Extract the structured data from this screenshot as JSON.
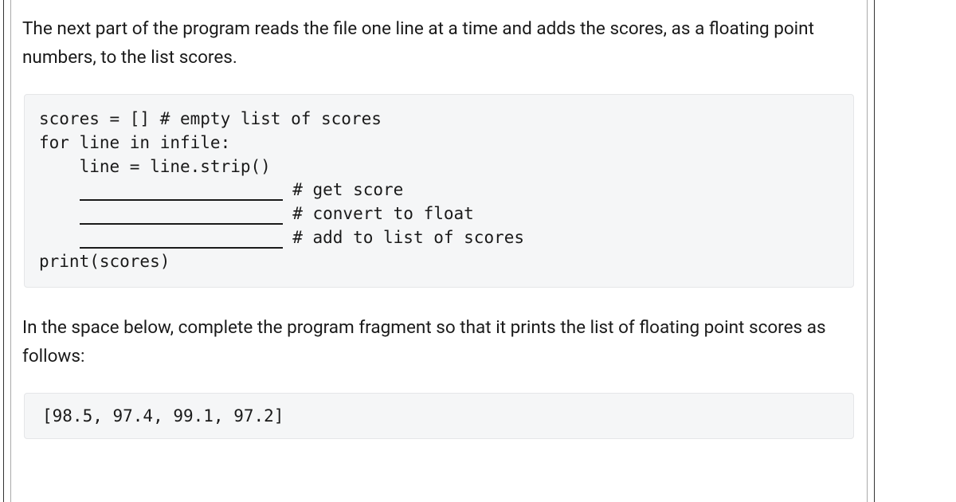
{
  "intro_paragraph": "The next part of the program reads the file one line at a time and adds the scores, as a floating point numbers, to the list scores.",
  "code": {
    "line1": "scores = [] # empty list of scores",
    "line2": "for line in infile:",
    "line3": "    line = line.strip()",
    "blank_indent": "    ",
    "comment1": " # get score",
    "comment2": " # convert to float",
    "comment3": " # add to list of scores",
    "line7": "print(scores)"
  },
  "instruction_paragraph": "In the space below, complete the program fragment so that it prints the list of floating point scores as follows:",
  "output": "[98.5, 97.4, 99.1, 97.2]"
}
